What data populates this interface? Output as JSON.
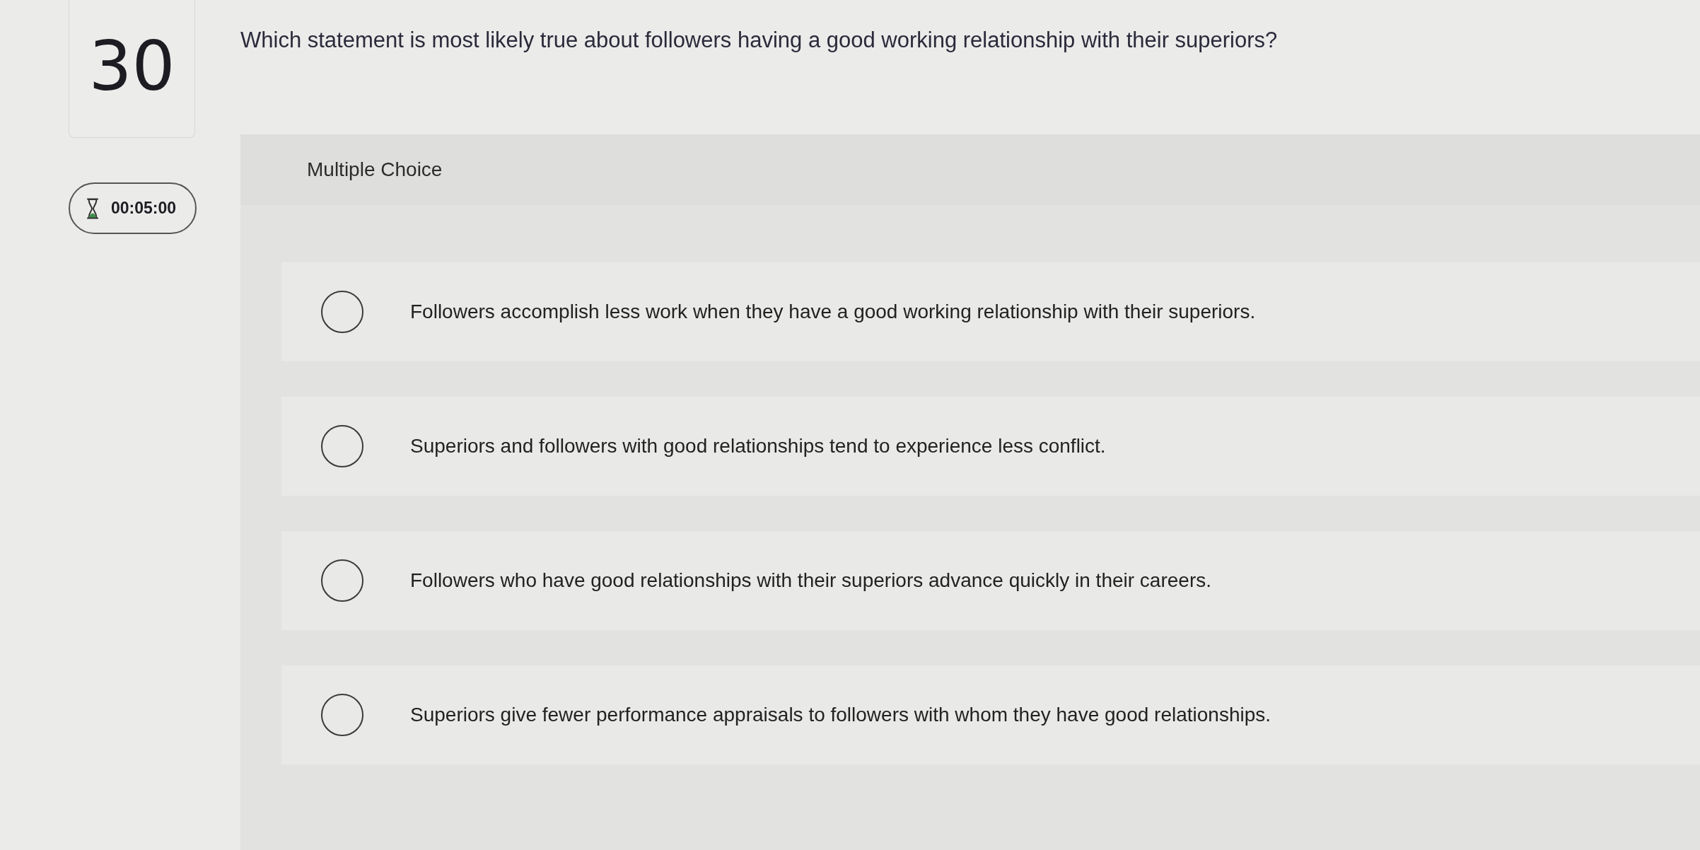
{
  "question": {
    "number": "30",
    "timer": "00:05:00",
    "text": "Which statement is most likely true about followers having a good working relationship with their superiors?"
  },
  "answer_panel": {
    "type_label": "Multiple Choice",
    "options": [
      {
        "text": "Followers accomplish less work when they have a good working relationship with their superiors.",
        "selected": false
      },
      {
        "text": "Superiors and followers with good relationships tend to experience less conflict.",
        "selected": false
      },
      {
        "text": "Followers who have good relationships with their superiors advance quickly in their careers.",
        "selected": false
      },
      {
        "text": "Superiors give fewer performance appraisals to followers with whom they have good relationships.",
        "selected": false
      }
    ]
  }
}
